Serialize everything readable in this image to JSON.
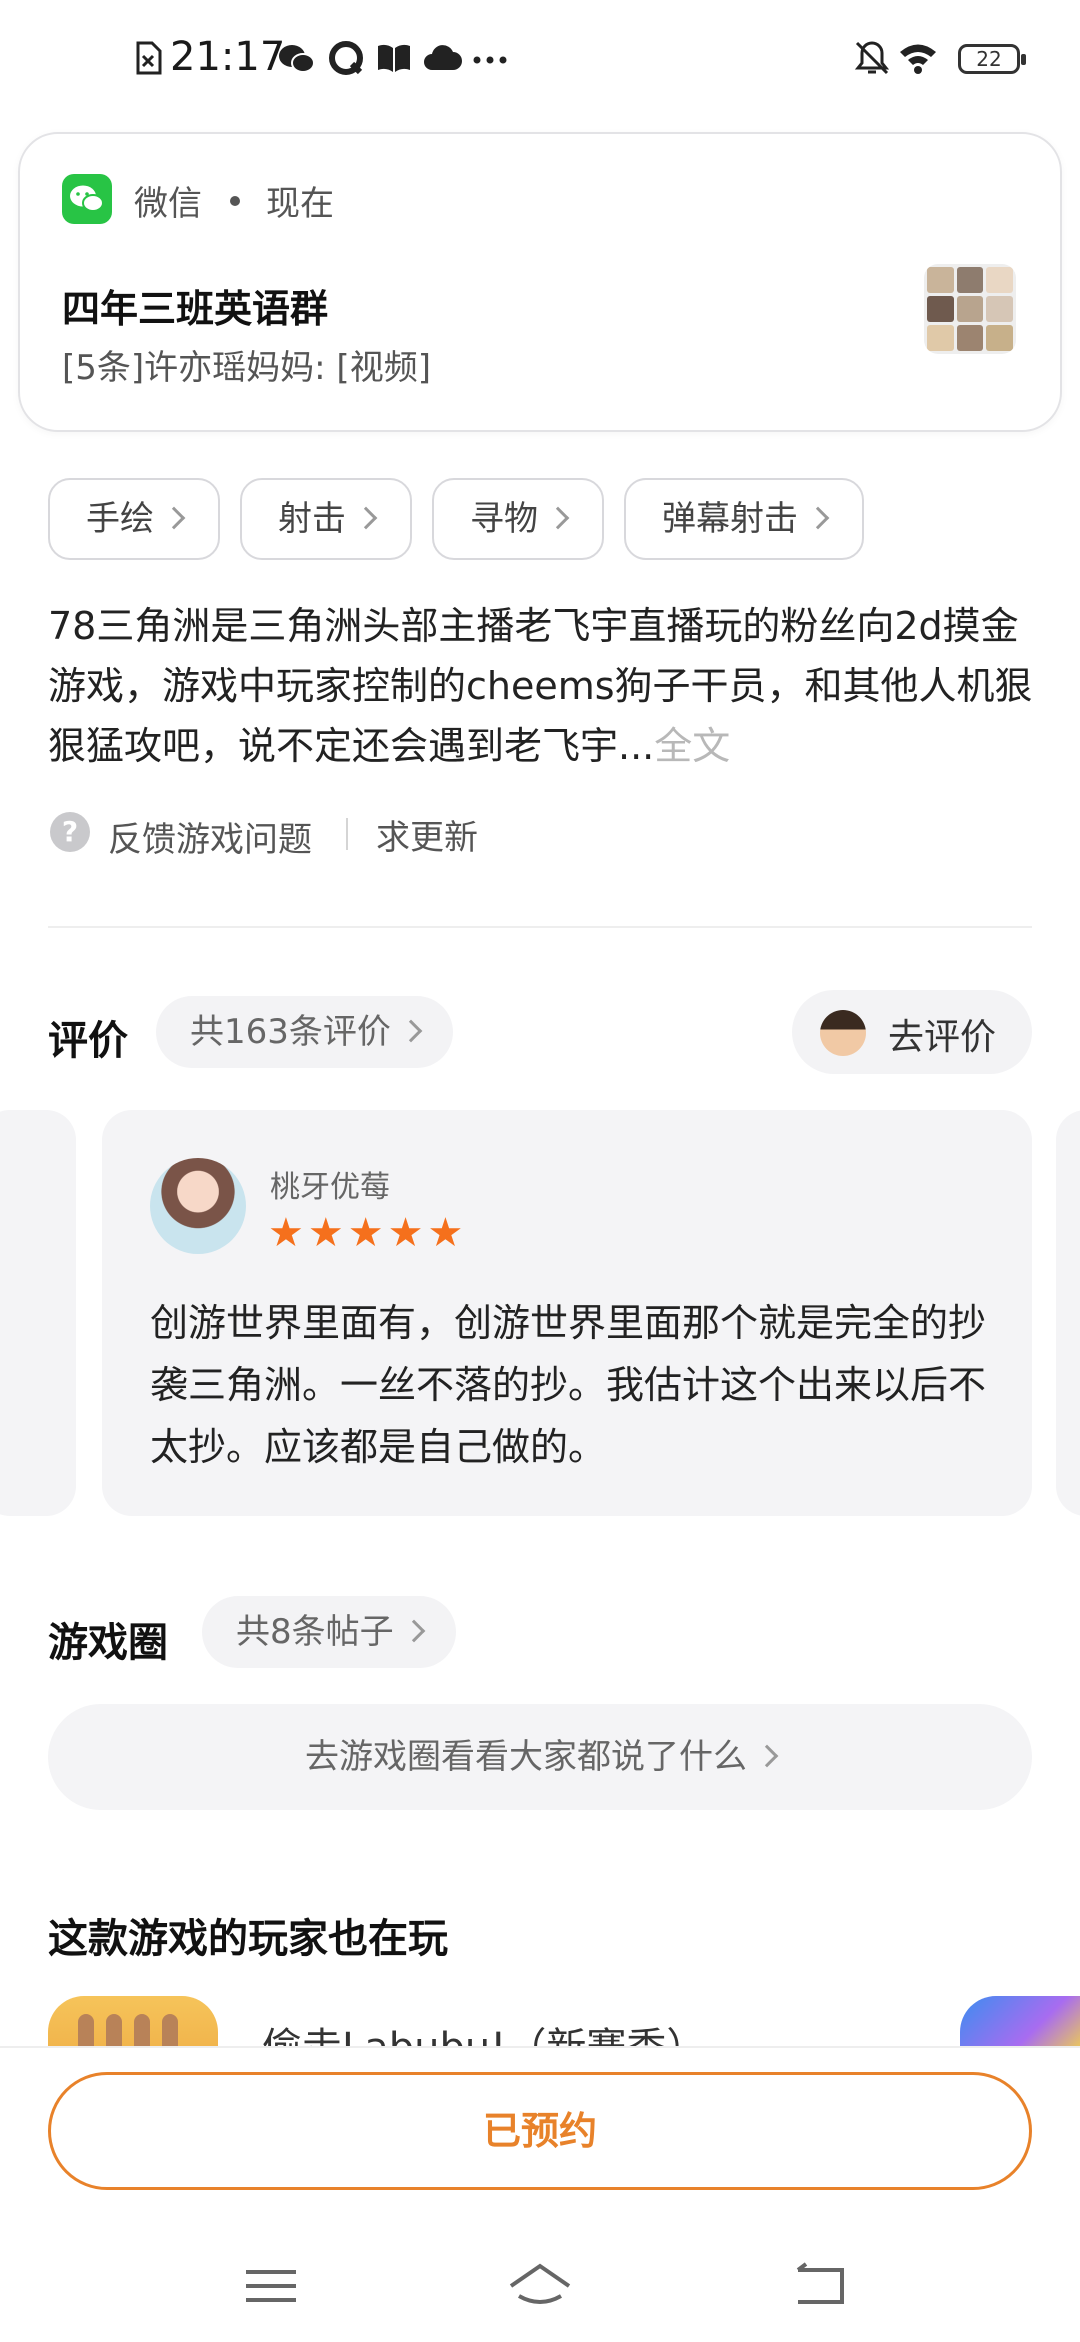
{
  "status_bar": {
    "time": "21:17",
    "battery": "22",
    "icons": [
      "sim-off-icon",
      "wechat-icon",
      "q-app-icon",
      "book-icon",
      "cloud-icon",
      "more-dots-icon",
      "mute-icon",
      "wifi-icon",
      "battery-icon"
    ]
  },
  "notification": {
    "app": "微信",
    "time": "现在",
    "title": "四年三班英语群",
    "body": "[5条]许亦瑶妈妈: [视频]"
  },
  "tags": [
    {
      "label": "手绘"
    },
    {
      "label": "射击"
    },
    {
      "label": "寻物"
    },
    {
      "label": "弹幕射击"
    }
  ],
  "description": {
    "text": "78三角洲是三角洲头部主播老飞宇直播玩的粉丝向2d摸金游戏，游戏中玩家控制的cheems狗子干员，和其他人机狠狠猛攻吧，说不定还会遇到老飞宇...",
    "more": "全文"
  },
  "feedback": {
    "help_icon": "?",
    "report": "反馈游戏问题",
    "request_update": "求更新"
  },
  "ratings": {
    "title": "评价",
    "count_label": "共163条评价",
    "go_rate": "去评价",
    "review": {
      "username": "桃牙优莓",
      "stars": "★★★★★",
      "star_count": 5,
      "text": "创游世界里面有，创游世界里面那个就是完全的抄袭三角洲。一丝不落的抄。我估计这个出来以后不太抄。应该都是自己做的。"
    }
  },
  "game_circle": {
    "title": "游戏圈",
    "count_label": "共8条帖子",
    "cta": "去游戏圈看看大家都说了什么"
  },
  "also_playing": {
    "title": "这款游戏的玩家也在玩",
    "games": [
      {
        "name": "偷走Labubu!（新赛季）"
      }
    ]
  },
  "bottom": {
    "reserved_button": "已预约"
  },
  "colors": {
    "accent": "#e8822a",
    "star": "#f5701c",
    "wechat_green": "#28c445"
  }
}
